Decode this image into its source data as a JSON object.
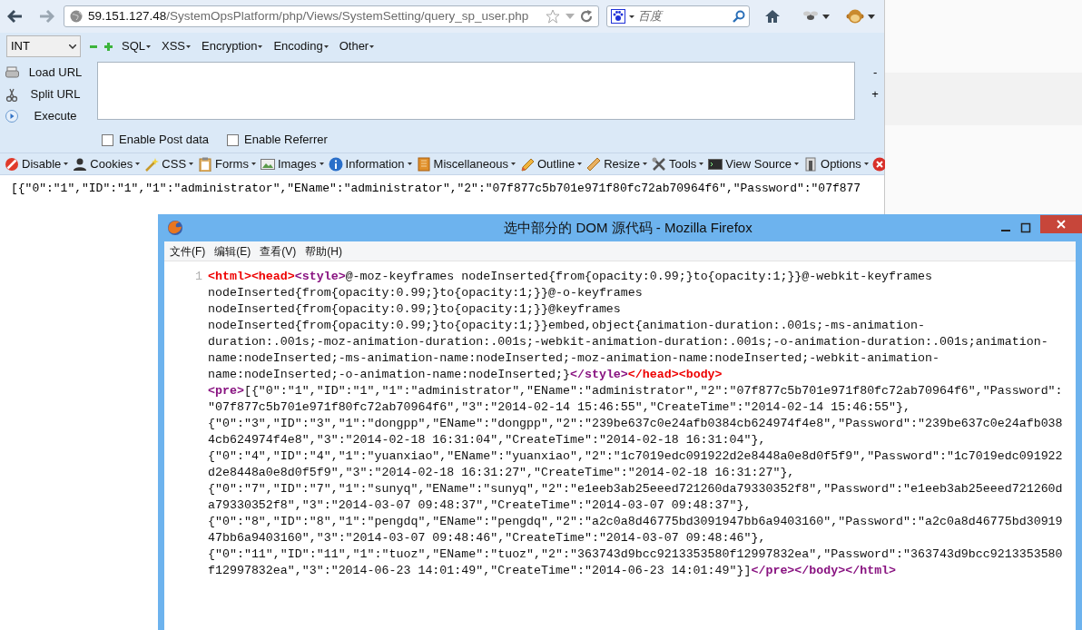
{
  "browser": {
    "nav": {
      "url_host": "59.151.127.48",
      "url_path": "/SystemOpsPlatform/php/Views/SystemSetting/query_sp_user.php",
      "search_placeholder": "百度"
    },
    "hackbar": {
      "select_value": "INT",
      "menus": [
        "SQL",
        "XSS",
        "Encryption",
        "Encoding",
        "Other"
      ],
      "actions": [
        "Load URL",
        "Split URL",
        "Execute"
      ],
      "side_buttons": [
        "-",
        "+"
      ],
      "checkboxes": [
        {
          "label": "Enable Post data",
          "checked": false
        },
        {
          "label": "Enable Referrer",
          "checked": false
        }
      ]
    },
    "dev_toolbar": [
      "Disable",
      "Cookies",
      "CSS",
      "Forms",
      "Images",
      "Information",
      "Miscellaneous",
      "Outline",
      "Resize",
      "Tools",
      "View Source",
      "Options"
    ],
    "page_text": "[{\"0\":\"1\",\"ID\":\"1\",\"1\":\"administrator\",\"EName\":\"administrator\",\"2\":\"07f877c5b701e971f80fc72ab70964f6\",\"Password\":\"07f877"
  },
  "source_window": {
    "title": "选中部分的 DOM 源代码 - Mozilla Firefox",
    "menu": [
      "文件(F)",
      "编辑(E)",
      "查看(V)",
      "帮助(H)"
    ],
    "line_number": "1",
    "lines": [
      [
        {
          "kind": "tag_red",
          "text": "<html>"
        },
        {
          "kind": "tag_red",
          "text": "<head>"
        },
        {
          "kind": "tag_purple",
          "text": "<style>"
        },
        {
          "kind": "text",
          "text": "@-moz-keyframes nodeInserted{from{opacity:0.99;}to{opacity:1;}}@-webkit-keyframes"
        }
      ],
      [
        {
          "kind": "text",
          "text": "nodeInserted{from{opacity:0.99;}to{opacity:1;}}@-o-keyframes"
        }
      ],
      [
        {
          "kind": "text",
          "text": "nodeInserted{from{opacity:0.99;}to{opacity:1;}}@keyframes"
        }
      ],
      [
        {
          "kind": "text",
          "text": "nodeInserted{from{opacity:0.99;}to{opacity:1;}}embed,object{animation-duration:.001s;-ms-animation-"
        }
      ],
      [
        {
          "kind": "text",
          "text": "duration:.001s;-moz-animation-duration:.001s;-webkit-animation-duration:.001s;-o-animation-duration:.001s;animation-"
        }
      ],
      [
        {
          "kind": "text",
          "text": "name:nodeInserted;-ms-animation-name:nodeInserted;-moz-animation-name:nodeInserted;-webkit-animation-"
        }
      ],
      [
        {
          "kind": "text",
          "text": "name:nodeInserted;-o-animation-name:nodeInserted;}"
        },
        {
          "kind": "tag_purple",
          "text": "</style>"
        },
        {
          "kind": "tag_red",
          "text": "</head>"
        },
        {
          "kind": "tag_red",
          "text": "<body>"
        }
      ],
      [
        {
          "kind": "tag_purple",
          "text": "<pre>"
        },
        {
          "kind": "text",
          "text": "[{\"0\":\"1\",\"ID\":\"1\",\"1\":\"administrator\",\"EName\":\"administrator\",\"2\":\"07f877c5b701e971f80fc72ab70964f6\",\"Password\":"
        }
      ],
      [
        {
          "kind": "text",
          "text": "\"07f877c5b701e971f80fc72ab70964f6\",\"3\":\"2014-02-14 15:46:55\",\"CreateTime\":\"2014-02-14 15:46:55\"},"
        }
      ],
      [
        {
          "kind": "text",
          "text": "{\"0\":\"3\",\"ID\":\"3\",\"1\":\"dongpp\",\"EName\":\"dongpp\",\"2\":\"239be637c0e24afb0384cb624974f4e8\",\"Password\":\"239be637c0e24afb038"
        }
      ],
      [
        {
          "kind": "text",
          "text": "4cb624974f4e8\",\"3\":\"2014-02-18 16:31:04\",\"CreateTime\":\"2014-02-18 16:31:04\"},"
        }
      ],
      [
        {
          "kind": "text",
          "text": "{\"0\":\"4\",\"ID\":\"4\",\"1\":\"yuanxiao\",\"EName\":\"yuanxiao\",\"2\":\"1c7019edc091922d2e8448a0e8d0f5f9\",\"Password\":\"1c7019edc091922"
        }
      ],
      [
        {
          "kind": "text",
          "text": "d2e8448a0e8d0f5f9\",\"3\":\"2014-02-18 16:31:27\",\"CreateTime\":\"2014-02-18 16:31:27\"},"
        }
      ],
      [
        {
          "kind": "text",
          "text": "{\"0\":\"7\",\"ID\":\"7\",\"1\":\"sunyq\",\"EName\":\"sunyq\",\"2\":\"e1eeb3ab25eeed721260da79330352f8\",\"Password\":\"e1eeb3ab25eeed721260d"
        }
      ],
      [
        {
          "kind": "text",
          "text": "a79330352f8\",\"3\":\"2014-03-07 09:48:37\",\"CreateTime\":\"2014-03-07 09:48:37\"},"
        }
      ],
      [
        {
          "kind": "text",
          "text": "{\"0\":\"8\",\"ID\":\"8\",\"1\":\"pengdq\",\"EName\":\"pengdq\",\"2\":\"a2c0a8d46775bd3091947bb6a9403160\",\"Password\":\"a2c0a8d46775bd30919"
        }
      ],
      [
        {
          "kind": "text",
          "text": "47bb6a9403160\",\"3\":\"2014-03-07 09:48:46\",\"CreateTime\":\"2014-03-07 09:48:46\"},"
        }
      ],
      [
        {
          "kind": "text",
          "text": "{\"0\":\"11\",\"ID\":\"11\",\"1\":\"tuoz\",\"EName\":\"tuoz\",\"2\":\"363743d9bcc9213353580f12997832ea\",\"Password\":\"363743d9bcc9213353580"
        }
      ],
      [
        {
          "kind": "text",
          "text": "f12997832ea\",\"3\":\"2014-06-23 14:01:49\",\"CreateTime\":\"2014-06-23 14:01:49\"}]"
        },
        {
          "kind": "tag_purple",
          "text": "</pre>"
        },
        {
          "kind": "tag_purple",
          "text": "</body>"
        },
        {
          "kind": "tag_purple",
          "text": "</html>"
        }
      ]
    ]
  }
}
